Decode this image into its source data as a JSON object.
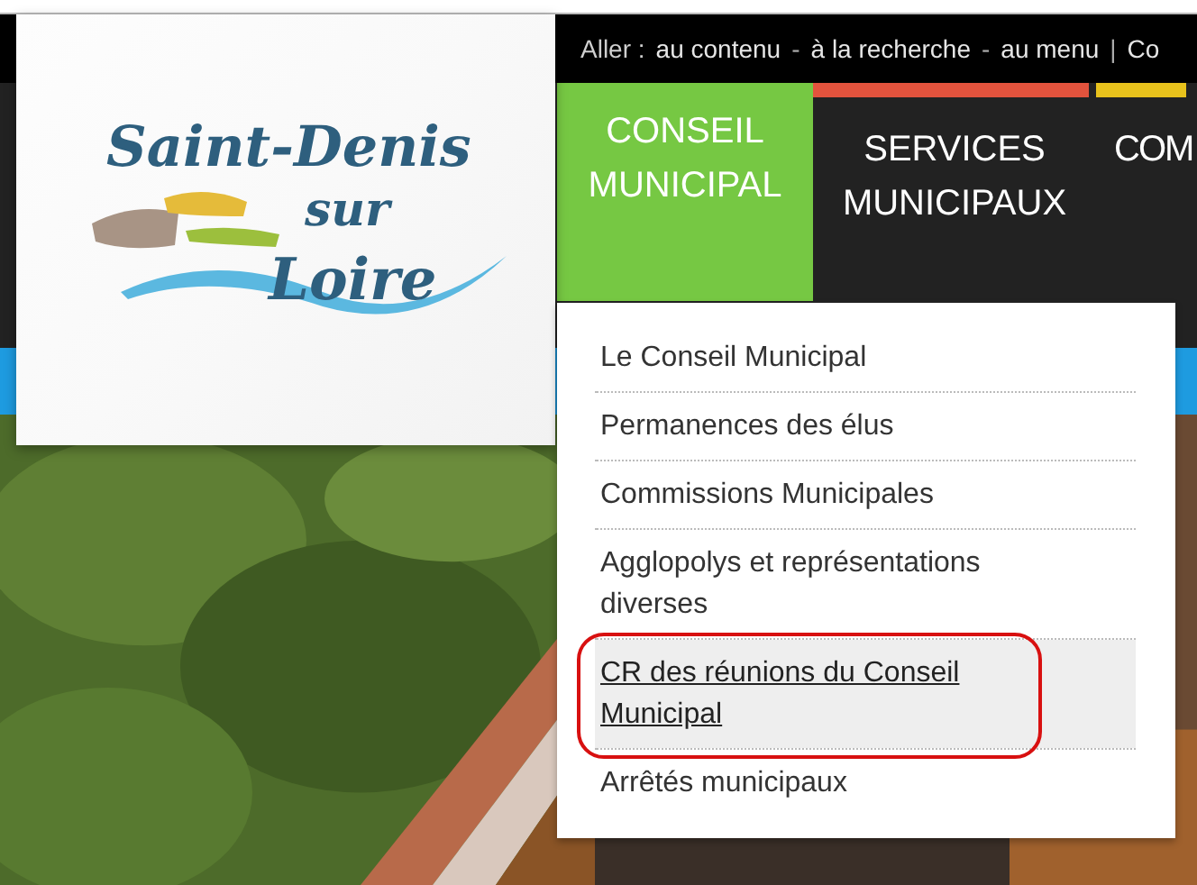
{
  "logo": {
    "lines": [
      "Saint-Denis",
      "sur",
      "Loire"
    ]
  },
  "skip_links": [
    {
      "kind": "label",
      "text": "Aller :"
    },
    {
      "kind": "link",
      "text": "au contenu"
    },
    {
      "kind": "sep",
      "text": "-"
    },
    {
      "kind": "link",
      "text": "à la recherche"
    },
    {
      "kind": "sep",
      "text": "-"
    },
    {
      "kind": "link",
      "text": "au menu"
    },
    {
      "kind": "sep",
      "text": "|"
    },
    {
      "kind": "link",
      "text": "Co"
    }
  ],
  "nav": {
    "tabs": [
      {
        "label": "CONSEIL MUNICIPAL",
        "selected": true,
        "color": "#76c843"
      },
      {
        "label": "SERVICES MUNICIPAUX",
        "selected": false,
        "color": "#e2533d"
      },
      {
        "label": "COM",
        "selected": false,
        "color": "#e8c21c"
      }
    ]
  },
  "dropdown": {
    "items": [
      {
        "label": "Le Conseil Municipal",
        "selected": false
      },
      {
        "label": "Permanences des élus",
        "selected": false
      },
      {
        "label": "Commissions Municipales",
        "selected": false
      },
      {
        "label": "Agglopolys et représentations diverses",
        "selected": false
      },
      {
        "label": "CR des réunions du Conseil Municipal",
        "selected": true
      },
      {
        "label": "Arrêtés municipaux",
        "selected": false
      }
    ]
  }
}
